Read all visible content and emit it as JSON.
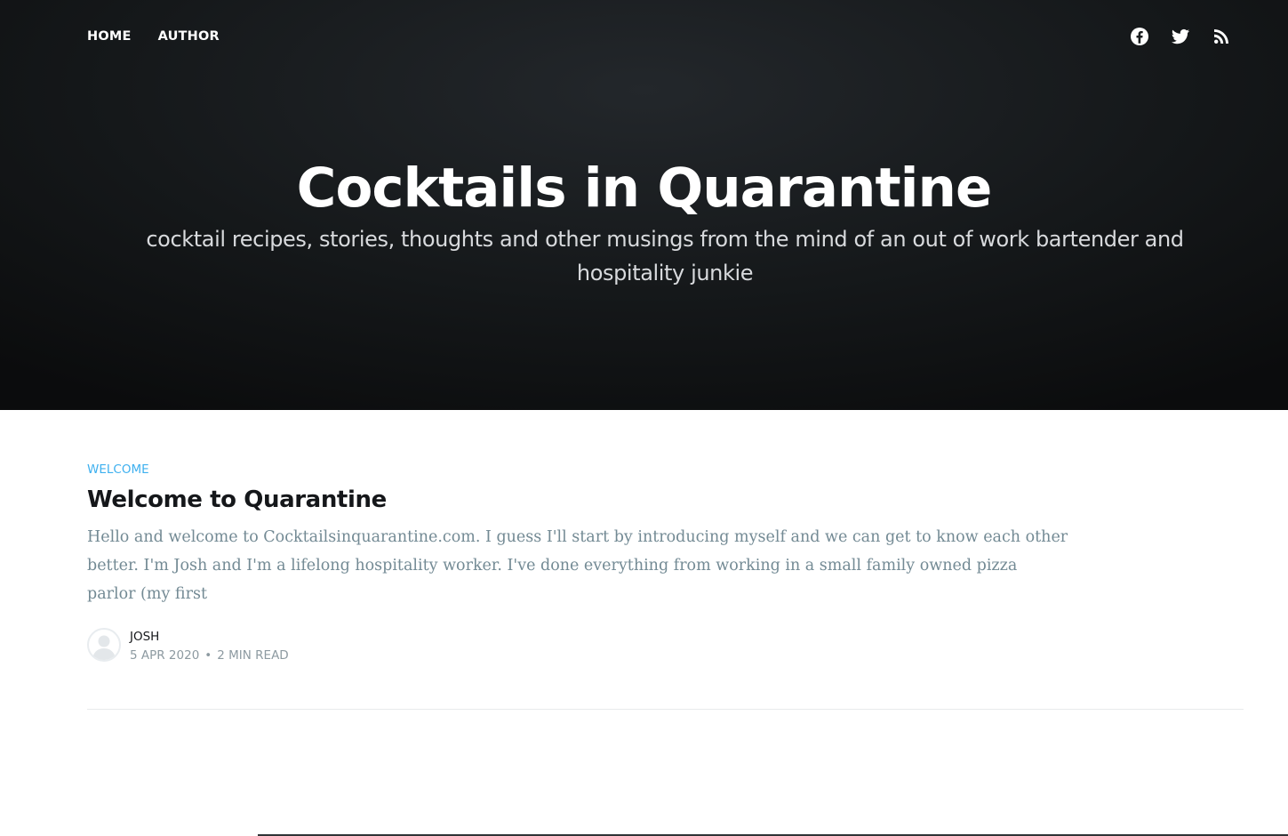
{
  "nav": {
    "items": [
      {
        "label": "HOME"
      },
      {
        "label": "AUTHOR"
      }
    ]
  },
  "social": [
    {
      "icon": "facebook-icon"
    },
    {
      "icon": "twitter-icon"
    },
    {
      "icon": "rss-icon"
    }
  ],
  "site": {
    "title": "Cocktails in Quarantine",
    "description": "cocktail recipes, stories, thoughts and other musings from the mind of an out of work bartender and hospitality junkie"
  },
  "post": {
    "tag": "WELCOME",
    "title": "Welcome to Quarantine",
    "excerpt": "Hello and  welcome to Cocktailsinquarantine.com. I guess I'll start by introducing myself and we can get to know each other better. I'm Josh and I'm a lifelong hospitality worker. I've done everything from working in a small family owned pizza parlor (my first",
    "author": "JOSH",
    "date": "5 APR 2020",
    "separator": "•",
    "reading_time": "2 MIN READ"
  },
  "colors": {
    "accent": "#3eb0ef",
    "hero_bg": "#15181a",
    "excerpt": "#738a94",
    "meta": "#8d9aa1"
  }
}
